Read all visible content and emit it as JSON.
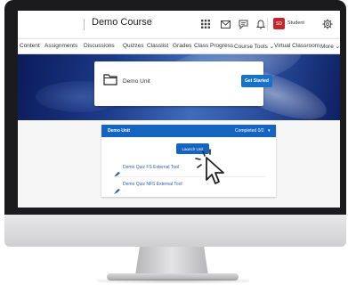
{
  "header": {
    "course_title": "Demo Course",
    "user_initials": "SD",
    "user_name": "Student",
    "icons": [
      "grid-icon",
      "mail-icon",
      "chat-icon",
      "bell-icon",
      "gear-icon"
    ]
  },
  "nav": {
    "items": [
      "Content",
      "Assignments",
      "Discussions",
      "Quizzes",
      "Classlist",
      "Grades",
      "Class Progress",
      "Course Tools ⌄",
      "Virtual Classroom",
      "More ⌄"
    ]
  },
  "unit_card": {
    "title": "Demo Unit",
    "get_started_label": "Get Started"
  },
  "panel": {
    "title": "Demo Unit",
    "progress": "Completed 0/2",
    "launch_label": "Launch Unit",
    "items": [
      "Demo Quiz FS External Tool",
      "Demo Quiz NFS External Tool"
    ]
  },
  "colors": {
    "accent": "#1565c0",
    "avatar": "#c0282d",
    "banner": "#1d3b8c"
  }
}
